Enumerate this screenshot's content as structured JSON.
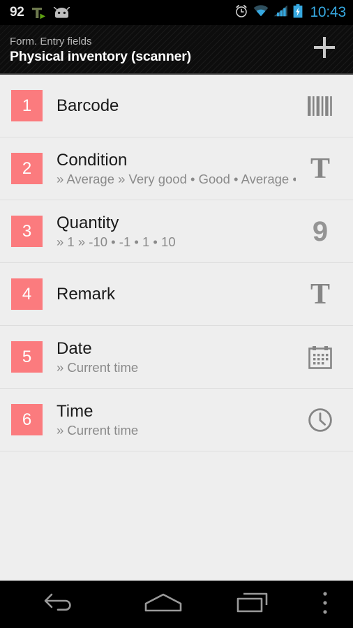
{
  "status_bar": {
    "left_number": "92",
    "icons_left": [
      "tapatalk-icon",
      "android-head-icon"
    ],
    "icons_right": [
      "alarm-icon",
      "wifi-icon",
      "signal-icon",
      "battery-charging-icon"
    ],
    "time": "10:43"
  },
  "action_bar": {
    "subtitle": "Form. Entry fields",
    "title": "Physical inventory (scanner)",
    "add_label": "+",
    "add_icon": "plus-icon"
  },
  "colors": {
    "badge": "#FB7B7E",
    "list_background": "#EEEEEE",
    "divider": "#DDDDDD",
    "action_bar": "#0D0D0D",
    "status_time": "#36A8E0",
    "title_text": "#1A1A1A",
    "subtitle_text": "#8A8A8A",
    "icon_gray": "#858585"
  },
  "list": {
    "items": [
      {
        "number": "1",
        "title": "Barcode",
        "subtitle": "",
        "icon": "barcode-icon"
      },
      {
        "number": "2",
        "title": "Condition",
        "subtitle": "» Average  » Very good • Good • Average •",
        "icon": "text-field-icon"
      },
      {
        "number": "3",
        "title": "Quantity",
        "subtitle": "» 1  » -10 • -1 • 1 • 10",
        "icon": "number-field-icon"
      },
      {
        "number": "4",
        "title": "Remark",
        "subtitle": "",
        "icon": "text-field-icon"
      },
      {
        "number": "5",
        "title": "Date",
        "subtitle": "» Current time",
        "icon": "calendar-icon"
      },
      {
        "number": "6",
        "title": "Time",
        "subtitle": "» Current time",
        "icon": "clock-icon"
      }
    ]
  },
  "nav_bar": {
    "back": "back-icon",
    "home": "home-icon",
    "recents": "recents-icon",
    "overflow": "overflow-menu-icon"
  }
}
